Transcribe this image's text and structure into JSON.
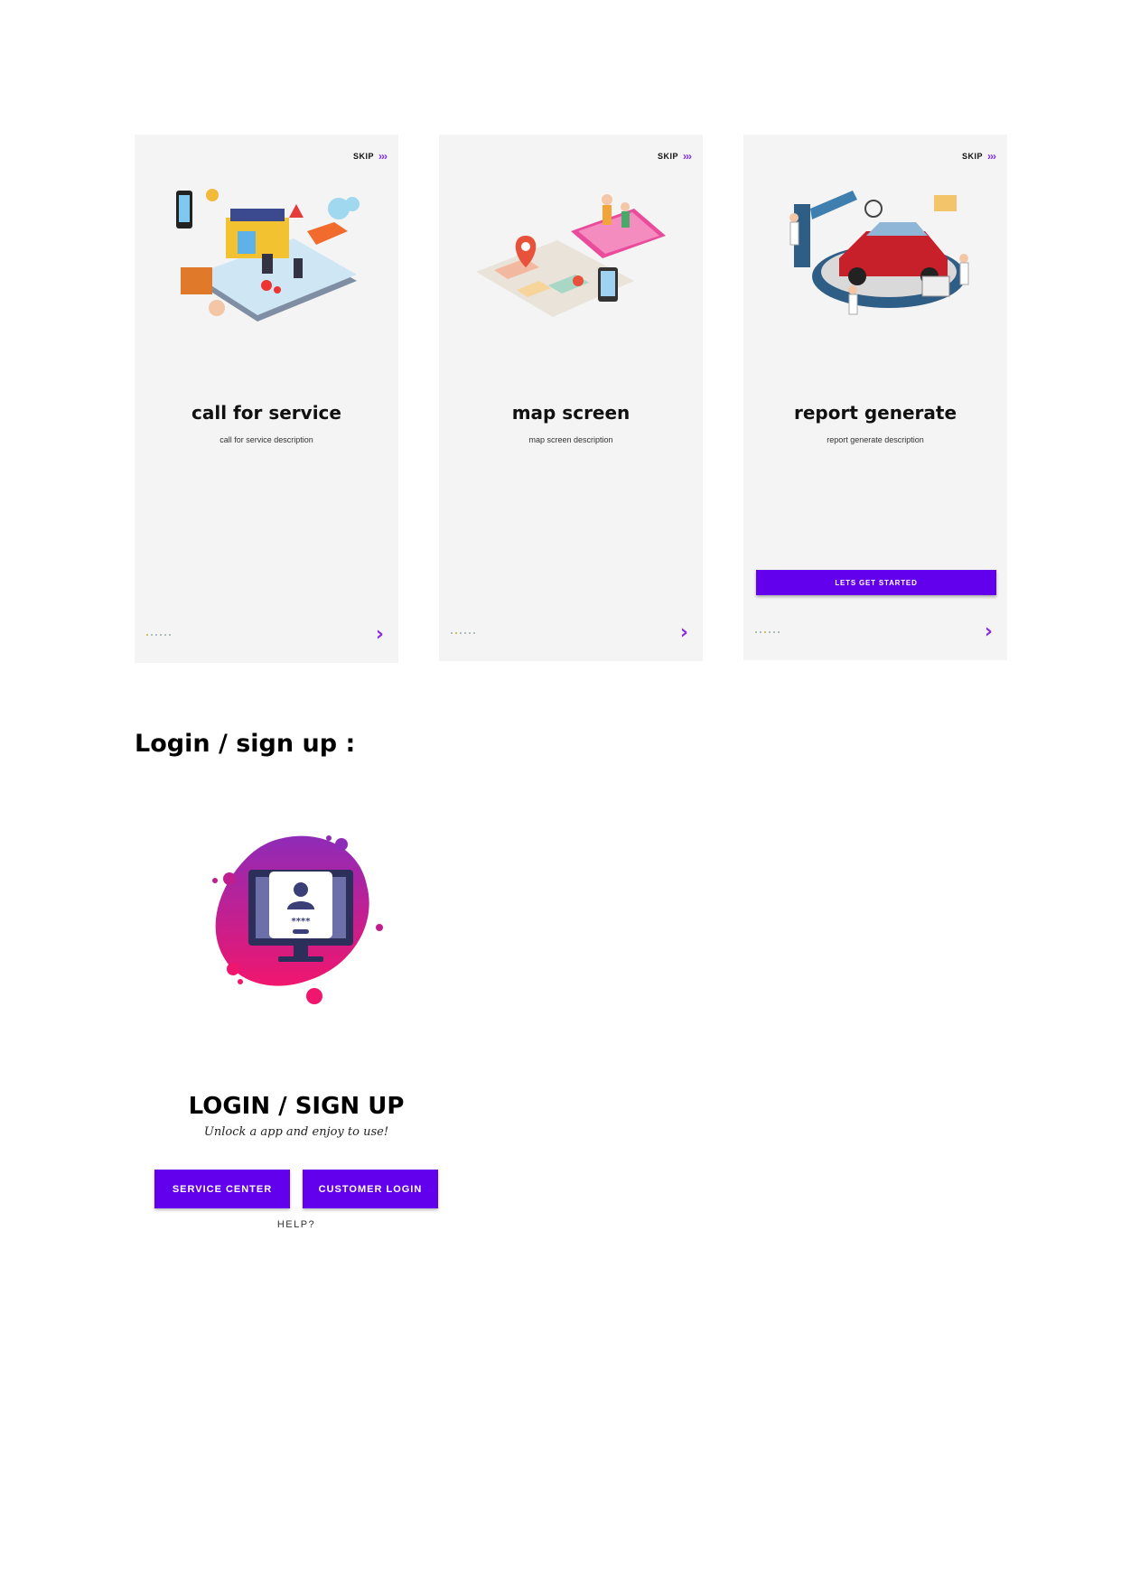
{
  "onboarding": {
    "skip_label": "SKIP",
    "skip_arrows": "›››",
    "next_arrow": "›",
    "screens": [
      {
        "title": "call for service",
        "description": "call for service description"
      },
      {
        "title": "map screen",
        "description": "map screen description"
      },
      {
        "title": "report generate",
        "description": "report generate description",
        "cta_label": "LETS GET STARTED"
      }
    ]
  },
  "section": {
    "heading": "Login / sign up :"
  },
  "login": {
    "title": "LOGIN / SIGN UP",
    "subtitle": "Unlock a app and enjoy to use!",
    "service_center_label": "SERVICE CENTER",
    "customer_login_label": "CUSTOMER LOGIN",
    "help_label": "HELP?",
    "password_mask": "****"
  },
  "colors": {
    "accent": "#6200ee",
    "arrow": "#8a2be2",
    "screen_bg": "#f4f4f4"
  },
  "icons": [
    "service-illustration",
    "map-illustration",
    "report-illustration",
    "login-illustration",
    "skip-arrows-icon",
    "next-arrow-icon"
  ]
}
